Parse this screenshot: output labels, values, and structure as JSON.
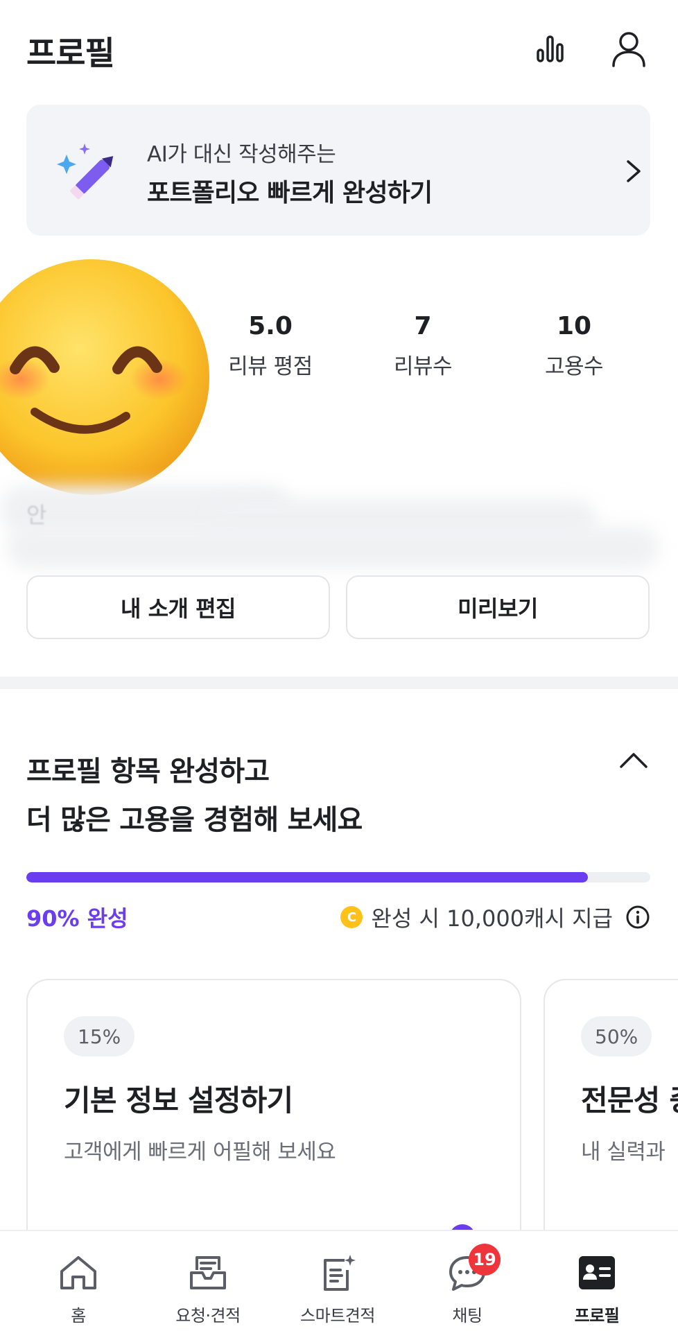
{
  "header": {
    "title": "프로필",
    "icons": [
      "stats-icon",
      "user-icon"
    ]
  },
  "ai_banner": {
    "subtitle": "AI가 대신 작성해주는",
    "title": "포트폴리오 빠르게 완성하기",
    "icons": [
      "magic-pen-icon",
      "chevron-right-icon"
    ]
  },
  "profile": {
    "avatar": "smiling-face-emoji",
    "stats": [
      {
        "value": "5.0",
        "label": "리뷰 평점"
      },
      {
        "value": "7",
        "label": "리뷰수"
      },
      {
        "value": "10",
        "label": "고용수"
      }
    ],
    "bio_snippet": "안"
  },
  "actions": {
    "edit_label": "내 소개 편집",
    "preview_label": "미리보기"
  },
  "completion": {
    "title_line1": "프로필 항목 완성하고",
    "title_line2": "더 많은 고용을 경험해 보세요",
    "progress": 0.9,
    "progress_label": "90% 완성",
    "reward_text": "완성 시 10,000캐시 지급",
    "coin_symbol": "C",
    "accent_color": "#6a3df0",
    "cards": [
      {
        "badge": "15%",
        "title": "기본 정보 설정하기",
        "desc": "고객에게 빠르게 어필해 보세요"
      },
      {
        "badge": "50%",
        "title": "전문성 증",
        "desc": "내 실력과"
      }
    ]
  },
  "bottom_nav": {
    "items": [
      {
        "label": "홈",
        "icon": "home-icon"
      },
      {
        "label": "요청·견적",
        "icon": "inbox-icon"
      },
      {
        "label": "스마트견적",
        "icon": "smart-quote-icon"
      },
      {
        "label": "채팅",
        "icon": "chat-icon",
        "badge": "19"
      },
      {
        "label": "프로필",
        "icon": "profile-card-icon",
        "active": true
      }
    ],
    "badge_color": "#f0343b"
  }
}
